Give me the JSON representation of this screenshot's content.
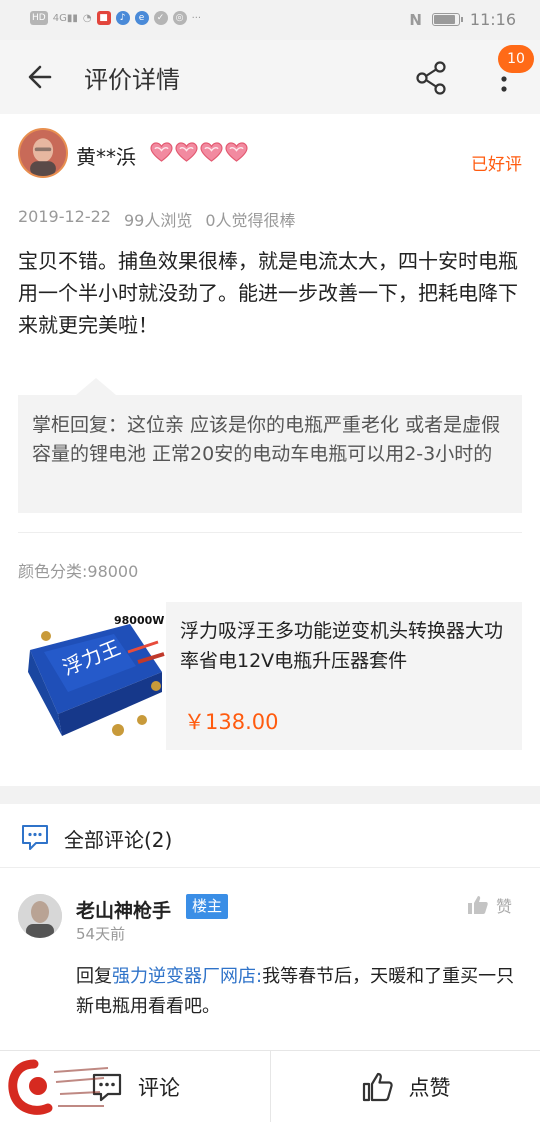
{
  "status_bar": {
    "network": "HD 4G",
    "time": "11:16",
    "battery_level": 0.9,
    "icons": [
      "hd-icon",
      "signal-icon",
      "wifi-icon",
      "app-icon",
      "music-icon",
      "browser-icon",
      "shield-icon",
      "gallery-icon",
      "more-dots-icon",
      "nfc-icon",
      "battery-icon"
    ]
  },
  "header": {
    "title": "评价详情",
    "badge_count": "10"
  },
  "review": {
    "user_name": "黄**浜",
    "rating_hearts": 4,
    "rating_tag": "已好评",
    "date": "2019-12-22",
    "views": "99人浏览",
    "likes": "0人觉得很棒",
    "text": "宝贝不错。捕鱼效果很棒，就是电流太大，四十安时电瓶用一个半小时就没劲了。能进一步改善一下，把耗电降下来就更完美啦！",
    "seller_reply": "掌柜回复：这位亲 应该是你的电瓶严重老化 或者是虚假容量的锂电池 正常20安的电动车电瓶可以用2-3小时的"
  },
  "sku": {
    "label": "颜色分类:98000"
  },
  "product": {
    "image_label": "98000W",
    "title": "浮力吸浮王多功能逆变机头转换器大功率省电12V电瓶升压器套件",
    "price": "￥138.00"
  },
  "comments": {
    "title": "全部评论(2)",
    "items": [
      {
        "name": "老山神枪手",
        "badge": "楼主",
        "time": "54天前",
        "like_label": "赞",
        "reply_prefix": "回复",
        "reply_target": "强力逆变器厂网店:",
        "text": "我等春节后，天暖和了重买一只新电瓶用看看吧。"
      }
    ]
  },
  "bottom_bar": {
    "comment_label": "评论",
    "like_label": "点赞"
  },
  "colors": {
    "accent_orange": "#ff5b0f",
    "badge_orange": "#ff6a17",
    "link_blue": "#2f73c9",
    "owner_blue": "#3a8ee6"
  }
}
